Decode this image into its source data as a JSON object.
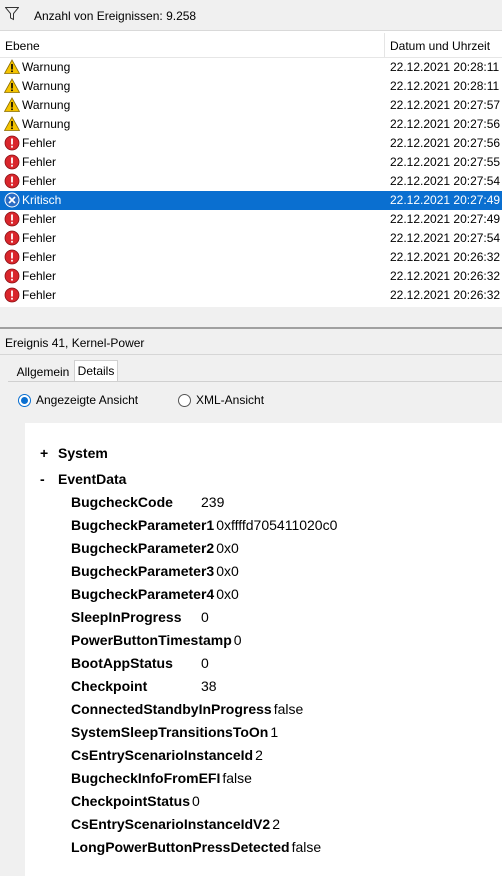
{
  "filter_bar": {
    "text": "Anzahl von Ereignissen: 9.258"
  },
  "table": {
    "columns": [
      "Ebene",
      "Datum und Uhrzeit"
    ],
    "rows": [
      {
        "level": "Warnung",
        "icon": "warning-icon",
        "datetime": "22.12.2021 20:28:11"
      },
      {
        "level": "Warnung",
        "icon": "warning-icon",
        "datetime": "22.12.2021 20:28:11"
      },
      {
        "level": "Warnung",
        "icon": "warning-icon",
        "datetime": "22.12.2021 20:27:57"
      },
      {
        "level": "Warnung",
        "icon": "warning-icon",
        "datetime": "22.12.2021 20:27:56"
      },
      {
        "level": "Fehler",
        "icon": "error-icon",
        "datetime": "22.12.2021 20:27:56"
      },
      {
        "level": "Fehler",
        "icon": "error-icon",
        "datetime": "22.12.2021 20:27:55"
      },
      {
        "level": "Fehler",
        "icon": "error-icon",
        "datetime": "22.12.2021 20:27:54"
      },
      {
        "level": "Kritisch",
        "icon": "critical-icon",
        "datetime": "22.12.2021 20:27:49",
        "selected": true
      },
      {
        "level": "Fehler",
        "icon": "error-icon",
        "datetime": "22.12.2021 20:27:49"
      },
      {
        "level": "Fehler",
        "icon": "error-icon",
        "datetime": "22.12.2021 20:27:54"
      },
      {
        "level": "Fehler",
        "icon": "error-icon",
        "datetime": "22.12.2021 20:26:32"
      },
      {
        "level": "Fehler",
        "icon": "error-icon",
        "datetime": "22.12.2021 20:26:32"
      },
      {
        "level": "Fehler",
        "icon": "error-icon",
        "datetime": "22.12.2021 20:26:32"
      }
    ]
  },
  "detail": {
    "title": "Ereignis 41, Kernel-Power",
    "tabs": {
      "general": "Allgemein",
      "details": "Details"
    },
    "view_options": {
      "friendly": "Angezeigte Ansicht",
      "xml": "XML-Ansicht"
    },
    "tree": {
      "system_toggle": "+",
      "system_label": "System",
      "eventdata_toggle": "-",
      "eventdata_label": "EventData",
      "items": [
        {
          "key": "BugcheckCode",
          "value": "239"
        },
        {
          "key": "BugcheckParameter1",
          "value": "0xffffd705411020c0"
        },
        {
          "key": "BugcheckParameter2",
          "value": "0x0"
        },
        {
          "key": "BugcheckParameter3",
          "value": "0x0"
        },
        {
          "key": "BugcheckParameter4",
          "value": "0x0"
        },
        {
          "key": "SleepInProgress",
          "value": "0"
        },
        {
          "key": "PowerButtonTimestamp",
          "value": "0"
        },
        {
          "key": "BootAppStatus",
          "value": "0"
        },
        {
          "key": "Checkpoint",
          "value": "38"
        },
        {
          "key": "ConnectedStandbyInProgress",
          "value": "false"
        },
        {
          "key": "SystemSleepTransitionsToOn",
          "value": "1"
        },
        {
          "key": "CsEntryScenarioInstanceId",
          "value": "2"
        },
        {
          "key": "BugcheckInfoFromEFI",
          "value": "false"
        },
        {
          "key": "CheckpointStatus",
          "value": "0"
        },
        {
          "key": "CsEntryScenarioInstanceIdV2",
          "value": "2"
        },
        {
          "key": "LongPowerButtonPressDetected",
          "value": "false"
        }
      ]
    }
  },
  "colors": {
    "selection": "#0a6fd0",
    "warning": "#f5c400",
    "error": "#d9262c",
    "critical": "#2b6cc4"
  }
}
